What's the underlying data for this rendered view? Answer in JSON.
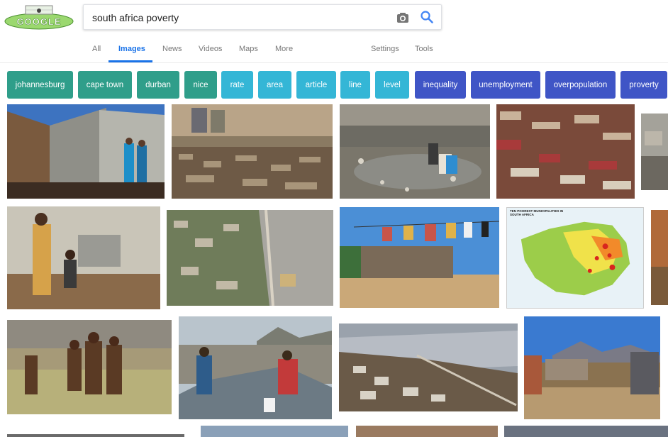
{
  "logo": {
    "text": "GOOGLE"
  },
  "search": {
    "query": "south africa poverty"
  },
  "tabs": [
    "All",
    "Images",
    "News",
    "Videos",
    "Maps",
    "More",
    "Settings",
    "Tools"
  ],
  "chips": [
    {
      "label": "johannesburg",
      "color": "#2f9e8a"
    },
    {
      "label": "cape town",
      "color": "#2f9e8a"
    },
    {
      "label": "durban",
      "color": "#2f9e8a"
    },
    {
      "label": "nice",
      "color": "#2f9e8a"
    },
    {
      "label": "rate",
      "color": "#34b6d6"
    },
    {
      "label": "area",
      "color": "#34b6d6"
    },
    {
      "label": "article",
      "color": "#34b6d6"
    },
    {
      "label": "line",
      "color": "#34b6d6"
    },
    {
      "label": "level",
      "color": "#34b6d6"
    },
    {
      "label": "inequality",
      "color": "#3f55c6"
    },
    {
      "label": "unemployment",
      "color": "#3f55c6"
    },
    {
      "label": "overpopulation",
      "color": "#3f55c6"
    },
    {
      "label": "proverty",
      "color": "#3f55c6"
    }
  ],
  "results": {
    "map_title": "TEN POOREST MUNICIPALITIES IN SOUTH AFRICA"
  }
}
